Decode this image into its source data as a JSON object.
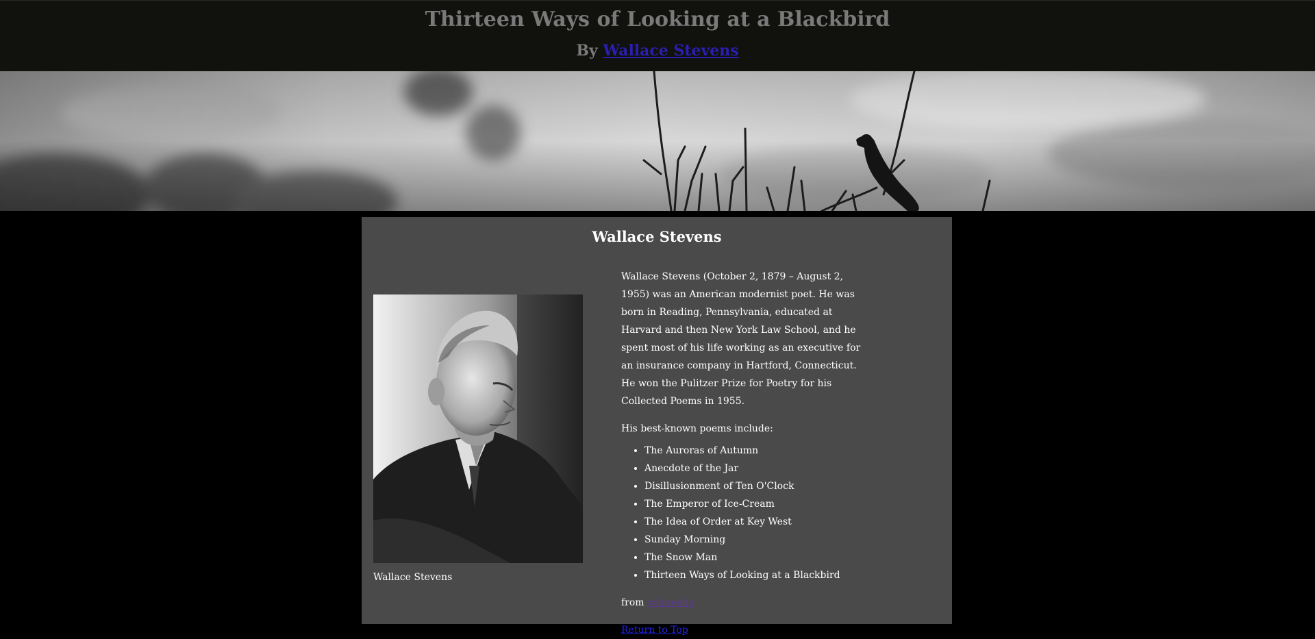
{
  "header": {
    "title": "Thirteen Ways of Looking at a Blackbird",
    "by_prefix": "By",
    "author_link": "Wallace Stevens"
  },
  "card": {
    "title": "Wallace Stevens",
    "portrait_caption": "Wallace Stevens",
    "bio": "Wallace Stevens (October 2, 1879 – August 2, 1955) was an American modernist poet. He was born in Reading, Pennsylvania, educated at Harvard and then New York Law School, and he spent most of his life working as an executive for an insurance company in Hartford, Connecticut. He won the Pulitzer Prize for Poetry for his Collected Poems in 1955.",
    "list_lead": "His best-known poems include:",
    "poems": [
      "The Auroras of Autumn",
      "Anecdote of the Jar",
      "Disillusionment of Ten O'Clock",
      "The Emperor of Ice-Cream",
      "The Idea of Order at Key West",
      "Sunday Morning",
      "The Snow Man",
      "Thirteen Ways of Looking at a Blackbird"
    ],
    "source_prefix": "from",
    "source_link": "wikipedia",
    "return_link": "Return to Top"
  },
  "colors": {
    "header_bg": "#11110e",
    "card_bg": "#4a4a4a",
    "page_bg": "#000000",
    "title_text": "#7a7a7a"
  }
}
